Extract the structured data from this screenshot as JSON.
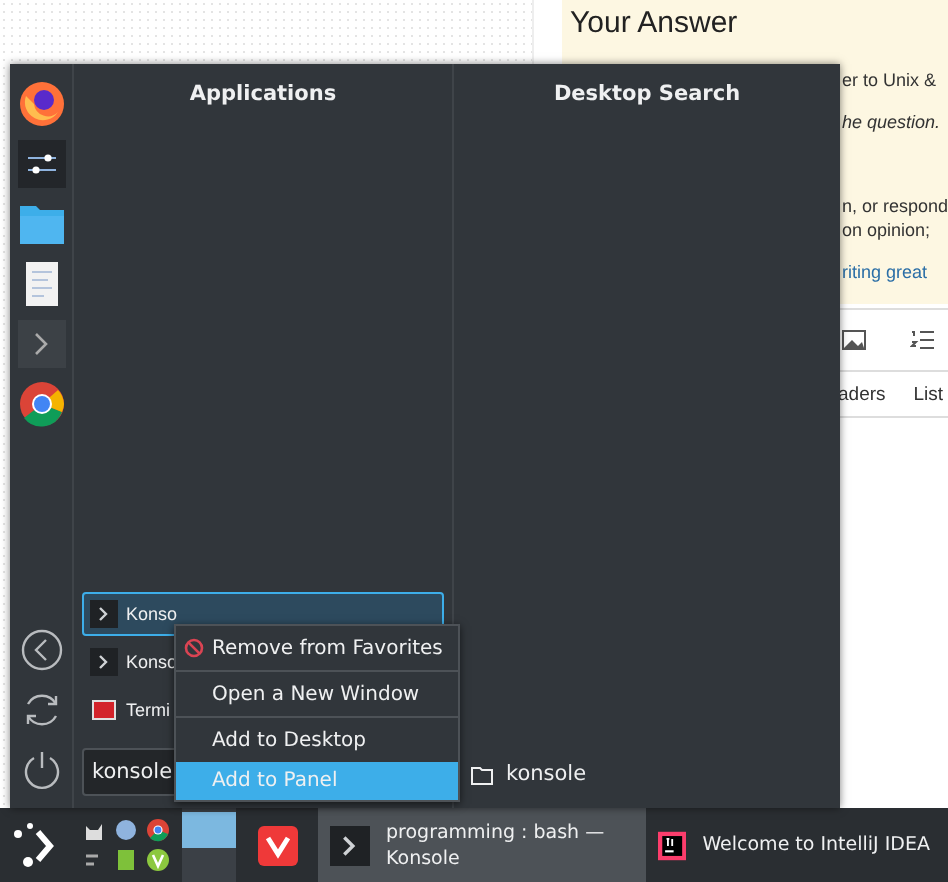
{
  "web_page": {
    "heading": "Your Answer",
    "lines": [
      {
        "text": "er to Unix &",
        "kind": "plain"
      },
      {
        "text": "he question.",
        "kind": "italic"
      },
      {
        "text": "n, or respond",
        "kind": "plain"
      },
      {
        "text": "on opinion;",
        "kind": "plain"
      },
      {
        "text": "riting great",
        "kind": "link"
      }
    ],
    "editor_tabs": [
      "aders",
      "List"
    ]
  },
  "launcher_menu": {
    "columns": [
      "Applications",
      "Desktop Search"
    ],
    "results": [
      {
        "label": "Konso",
        "kind": "konsole",
        "selected": true
      },
      {
        "label": "Konso",
        "kind": "konsole",
        "selected": false
      },
      {
        "label": "Termi",
        "kind": "terminal",
        "selected": false
      }
    ],
    "search": {
      "value": "konsole"
    },
    "desktop_search_results": [
      {
        "label": "konsole",
        "kind": "folder"
      }
    ],
    "context_menu": [
      [
        {
          "label": "Remove from Favorites",
          "kind": "remove",
          "selected": false
        }
      ],
      [
        {
          "label": "Open a New Window",
          "kind": "plain",
          "selected": false
        }
      ],
      [
        {
          "label": "Add to Desktop",
          "kind": "plain",
          "selected": false
        },
        {
          "label": "Add to Panel",
          "kind": "plain",
          "selected": true
        }
      ]
    ]
  },
  "taskbar": {
    "tasks": [
      {
        "title_lines": [
          "programming : bash —",
          "Konsole"
        ],
        "kind": "terminal",
        "active": true
      },
      {
        "title_lines": [
          "Welcome to IntelliJ IDEA"
        ],
        "kind": "intellij",
        "active": false
      }
    ]
  }
}
